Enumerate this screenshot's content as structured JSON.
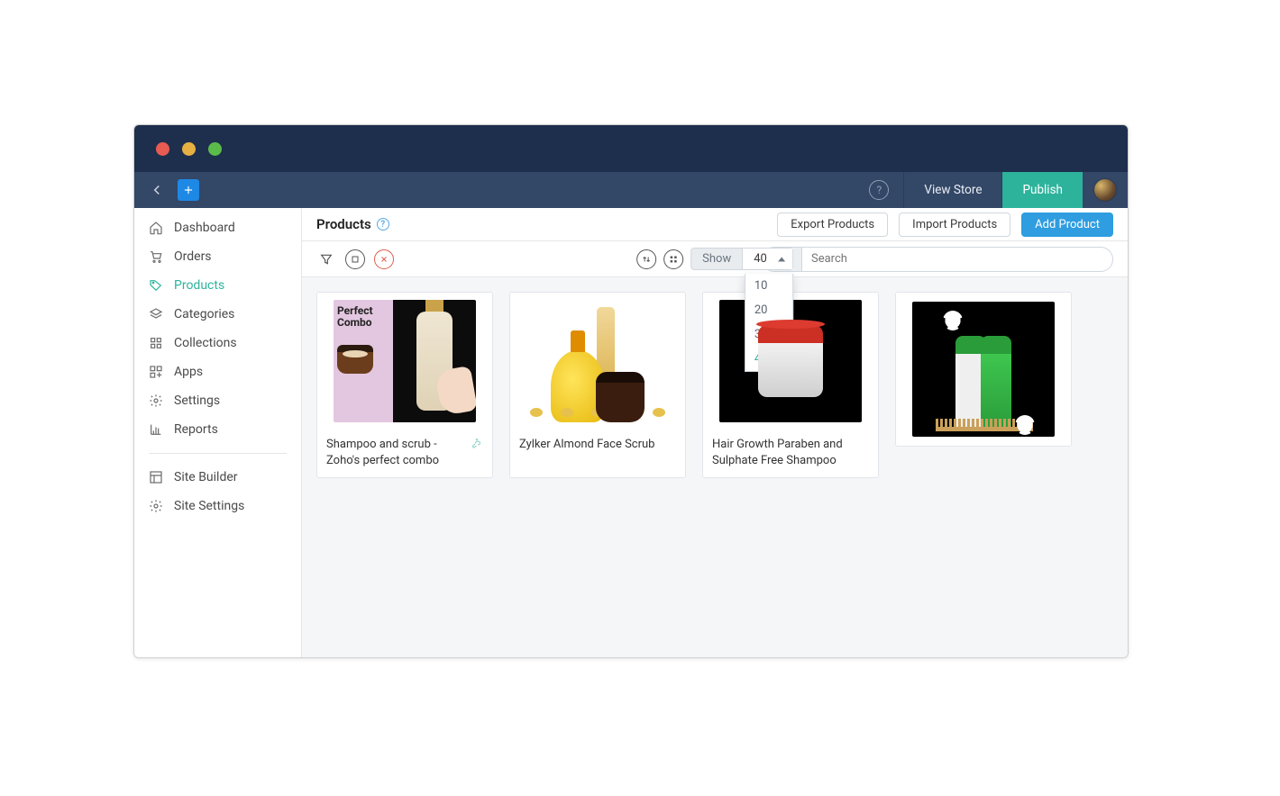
{
  "traffic_lights": {
    "red": "red",
    "yellow": "yellow",
    "green": "green"
  },
  "toolbar": {
    "view_store": "View Store",
    "publish": "Publish"
  },
  "sidebar": {
    "items": [
      {
        "id": "dashboard",
        "label": "Dashboard",
        "icon": "home"
      },
      {
        "id": "orders",
        "label": "Orders",
        "icon": "cart"
      },
      {
        "id": "products",
        "label": "Products",
        "icon": "tag",
        "active": true
      },
      {
        "id": "categories",
        "label": "Categories",
        "icon": "layers"
      },
      {
        "id": "collections",
        "label": "Collections",
        "icon": "grid"
      },
      {
        "id": "apps",
        "label": "Apps",
        "icon": "apps"
      },
      {
        "id": "settings",
        "label": "Settings",
        "icon": "gear"
      },
      {
        "id": "reports",
        "label": "Reports",
        "icon": "chart"
      }
    ],
    "secondary": [
      {
        "id": "site-builder",
        "label": "Site Builder",
        "icon": "layout"
      },
      {
        "id": "site-settings",
        "label": "Site Settings",
        "icon": "gear"
      }
    ]
  },
  "page": {
    "title": "Products",
    "actions": {
      "export": "Export Products",
      "import": "Import Products",
      "add": "Add Product"
    }
  },
  "filterbar": {
    "show_label": "Show",
    "show_value": "40",
    "show_options": [
      "10",
      "20",
      "30",
      "40"
    ],
    "show_selected": "40",
    "search_placeholder": "Search"
  },
  "products": [
    {
      "id": "p1",
      "title": "Shampoo and scrub - Zoho's perfect combo",
      "overlay_line1": "Perfect",
      "overlay_line2": "Combo",
      "has_affiliate_icon": true
    },
    {
      "id": "p2",
      "title": "Zylker Almond Face Scrub"
    },
    {
      "id": "p3",
      "title": "Hair Growth Paraben and Sulphate Free Shampoo"
    },
    {
      "id": "p4",
      "title": ""
    }
  ]
}
